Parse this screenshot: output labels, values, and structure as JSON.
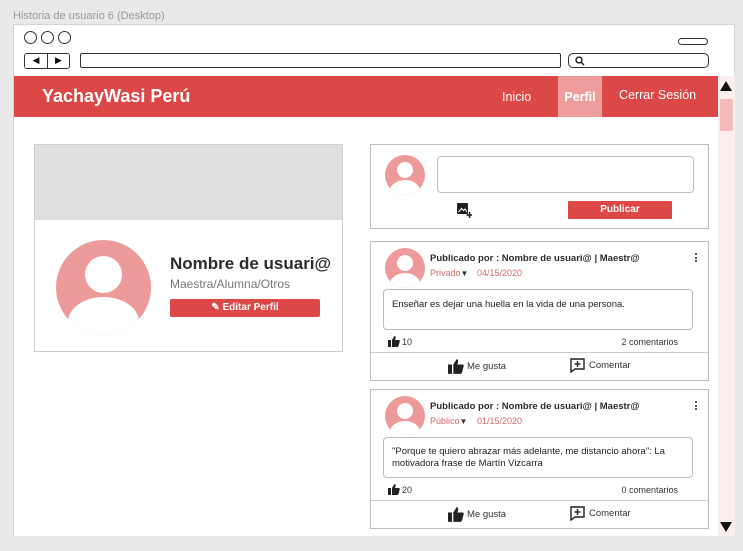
{
  "frame": {
    "title": "Historia de usuario 6 (Desktop)"
  },
  "browser": {
    "back": "◀",
    "forward": "▶"
  },
  "navbar": {
    "brand": "YachayWasi Perú",
    "items": [
      {
        "label": "Inicio"
      },
      {
        "label": "Perfil",
        "active": true
      },
      {
        "label": "Cerrar Sesión"
      }
    ]
  },
  "profile": {
    "name": "Nombre de usuari@",
    "role": "Maestra/Alumna/Otros",
    "edit_label": "✎ Editar Perfil"
  },
  "composer": {
    "placeholder": "",
    "publish_label": "Publicar"
  },
  "posts": [
    {
      "author": "Publicado por : Nombre de usuari@ | Maestr@",
      "privacy": "Privado",
      "date": "04/15/2020",
      "text": "Enseñar es dejar una huella en la vida de una persona.",
      "likes": "10",
      "comments": "2 comentarios",
      "like_label": "Me gusta",
      "comment_label": "Comentar"
    },
    {
      "author": "Publicado por : Nombre de usuari@ | Maestr@",
      "privacy": "Público",
      "date": "01/15/2020",
      "text": "\"Porque te quiero abrazar más adelante, me distancio ahora\": La motivadora frase de Martín Vizcarra",
      "likes": "20",
      "comments": "0 comentarios",
      "like_label": "Me gusta",
      "comment_label": "Comentar"
    }
  ],
  "colors": {
    "accent": "#dc4848",
    "accent_light": "#ec9a9a",
    "active_tab": "#ee9d9d"
  }
}
